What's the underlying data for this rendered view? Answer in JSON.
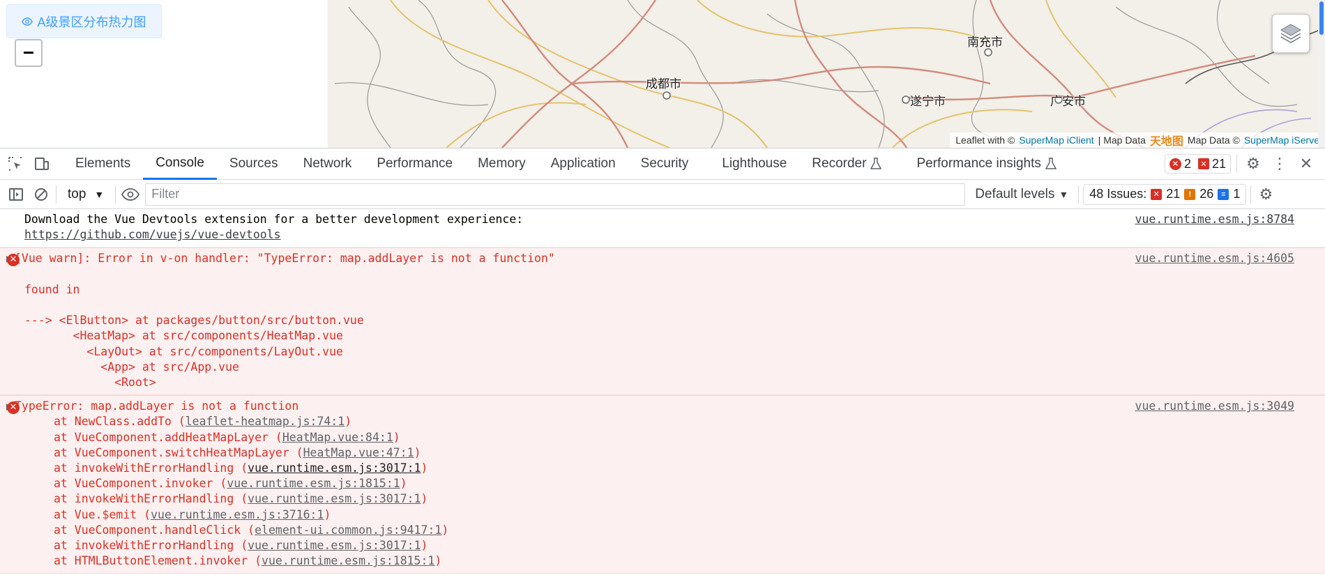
{
  "map": {
    "heat_button_label": "A级景区分布热力图",
    "zoom_out_label": "−",
    "cities": [
      "成都市",
      "南充市",
      "遂宁市",
      "广安市"
    ],
    "attribution": {
      "prefix": "Leaflet with ©",
      "client_link": "SuperMap iClient",
      "middle": "| Map Data",
      "logo": "天地图",
      "suffix": "Map Data ©",
      "server_link": "SuperMap iServe"
    }
  },
  "devtools": {
    "tabs": [
      "Elements",
      "Console",
      "Sources",
      "Network",
      "Performance",
      "Memory",
      "Application",
      "Security",
      "Lighthouse",
      "Recorder",
      "Performance insights"
    ],
    "active_tab": "Console",
    "error_count": "2",
    "issue_flag_count": "21",
    "toolbar": {
      "context": "top",
      "filter_placeholder": "Filter",
      "levels": "Default levels",
      "issues_label": "48 Issues:",
      "issues_errors": "21",
      "issues_warnings": "26",
      "issues_info": "1"
    },
    "messages": [
      {
        "type": "info",
        "text": "Download the Vue Devtools extension for a better development experience:",
        "link": "https://github.com/vuejs/vue-devtools",
        "source": "vue.runtime.esm.js:8784"
      },
      {
        "type": "error",
        "text": "[Vue warn]: Error in v-on handler: \"TypeError: map.addLayer is not a function\"",
        "source": "vue.runtime.esm.js:4605",
        "found_in": "found in",
        "trace": [
          "---> <ElButton> at packages/button/src/button.vue",
          "       <HeatMap> at src/components/HeatMap.vue",
          "         <LayOut> at src/components/LayOut.vue",
          "           <App> at src/App.vue",
          "             <Root>"
        ]
      },
      {
        "type": "error",
        "text": "TypeError: map.addLayer is not a function",
        "source": "vue.runtime.esm.js:3049",
        "stack": [
          {
            "prefix": "at NewClass.addTo (",
            "link": "leaflet-heatmap.js:74:1",
            "suffix": ")"
          },
          {
            "prefix": "at VueComponent.addHeatMapLayer (",
            "link": "HeatMap.vue:84:1",
            "suffix": ")"
          },
          {
            "prefix": "at VueComponent.switchHeatMapLayer (",
            "link": "HeatMap.vue:47:1",
            "suffix": ")"
          },
          {
            "prefix": "at invokeWithErrorHandling (",
            "link": "vue.runtime.esm.js:3017:1",
            "suffix": ")"
          },
          {
            "prefix": "at VueComponent.invoker (",
            "link": "vue.runtime.esm.js:1815:1",
            "suffix": ")"
          },
          {
            "prefix": "at invokeWithErrorHandling (",
            "link": "vue.runtime.esm.js:3017:1",
            "suffix": ")"
          },
          {
            "prefix": "at Vue.$emit (",
            "link": "vue.runtime.esm.js:3716:1",
            "suffix": ")"
          },
          {
            "prefix": "at VueComponent.handleClick (",
            "link": "element-ui.common.js:9417:1",
            "suffix": ")"
          },
          {
            "prefix": "at invokeWithErrorHandling (",
            "link": "vue.runtime.esm.js:3017:1",
            "suffix": ")"
          },
          {
            "prefix": "at HTMLButtonElement.invoker (",
            "link": "vue.runtime.esm.js:1815:1",
            "suffix": ")"
          }
        ]
      }
    ]
  }
}
